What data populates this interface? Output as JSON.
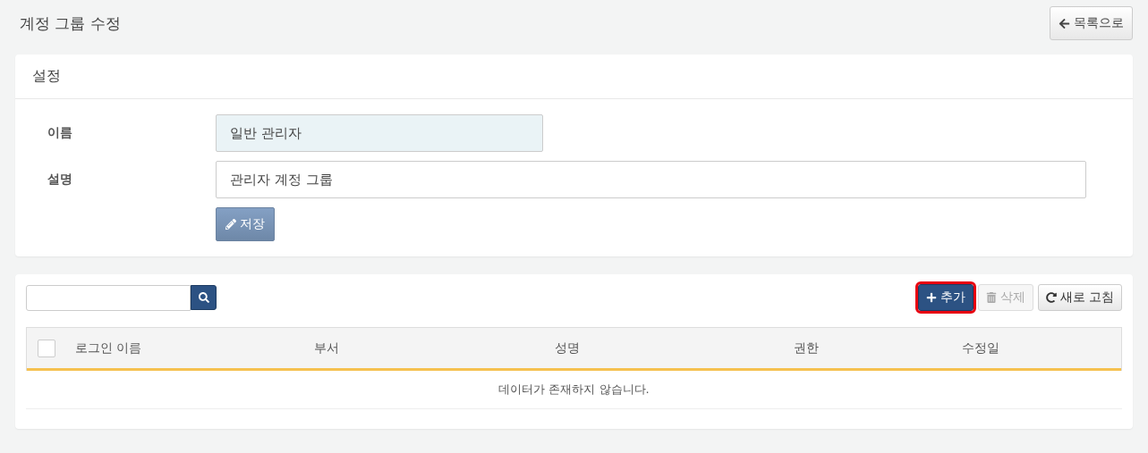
{
  "page": {
    "title": "계정 그룹 수정",
    "back_button": "목록으로"
  },
  "settings": {
    "title": "설정",
    "fields": [
      {
        "label": "이름",
        "value": "일반 관리자",
        "readonly": true
      },
      {
        "label": "설명",
        "value": "관리자 계정 그룹",
        "readonly": false
      }
    ],
    "save_button": {
      "label": "저장",
      "disabled": true
    }
  },
  "toolbar": {
    "buttons": [
      {
        "kind": "add",
        "label": "추가",
        "disabled": false,
        "highlighted": true
      },
      {
        "kind": "delete",
        "label": "삭제",
        "disabled": true,
        "highlighted": false
      },
      {
        "kind": "refresh",
        "label": "새로 고침",
        "disabled": false,
        "highlighted": false
      }
    ]
  },
  "table": {
    "select_all": {
      "checked": false
    },
    "columns": [
      "로그인 이름",
      "부서",
      "성명",
      "권한",
      "수정일"
    ],
    "empty_message": "데이터가 존재하지 않습니다."
  }
}
